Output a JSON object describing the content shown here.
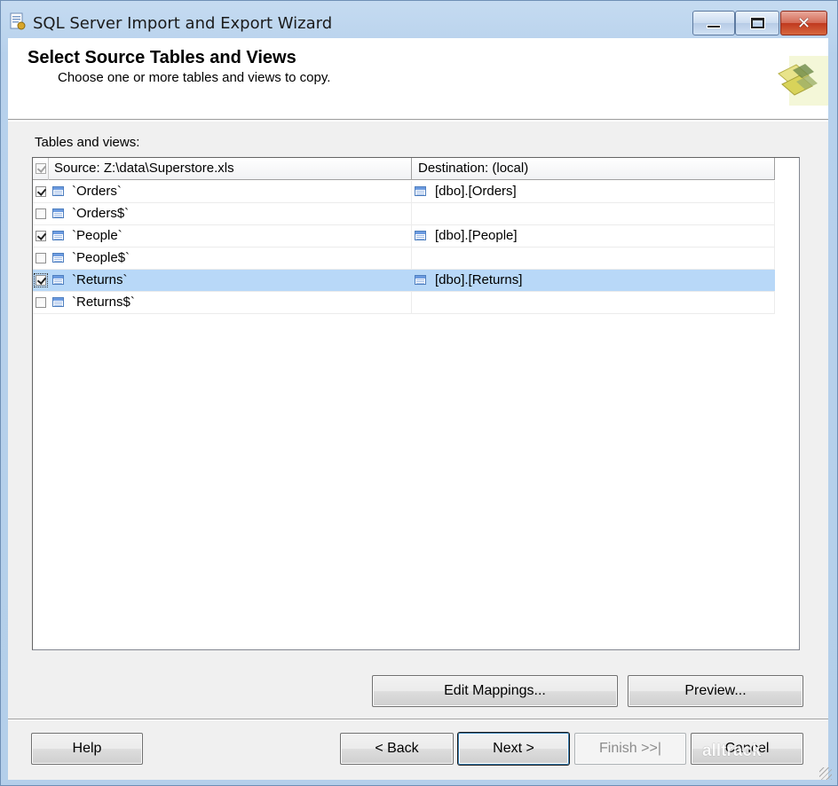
{
  "window": {
    "title": "SQL Server Import and Export Wizard",
    "close_glyph": "✕"
  },
  "header": {
    "title": "Select Source Tables and Views",
    "subtitle": "Choose one or more tables and views to copy."
  },
  "tables_label": "Tables and views:",
  "grid": {
    "columns": {
      "source": "Source: Z:\\data\\Superstore.xls",
      "destination": "Destination: (local)"
    },
    "rows": [
      {
        "checked": true,
        "source": "`Orders`",
        "destination": "[dbo].[Orders]",
        "selected": false
      },
      {
        "checked": false,
        "source": "`Orders$`",
        "destination": "",
        "selected": false
      },
      {
        "checked": true,
        "source": "`People`",
        "destination": "[dbo].[People]",
        "selected": false
      },
      {
        "checked": false,
        "source": "`People$`",
        "destination": "",
        "selected": false
      },
      {
        "checked": true,
        "source": "`Returns`",
        "destination": "[dbo].[Returns]",
        "selected": true
      },
      {
        "checked": false,
        "source": "`Returns$`",
        "destination": "",
        "selected": false
      }
    ]
  },
  "buttons": {
    "edit_mappings": "Edit Mappings...",
    "preview": "Preview...",
    "help": "Help",
    "back": "< Back",
    "next": "Next >",
    "finish": "Finish >>|",
    "cancel": "Cancel"
  },
  "watermark": "alltrack"
}
